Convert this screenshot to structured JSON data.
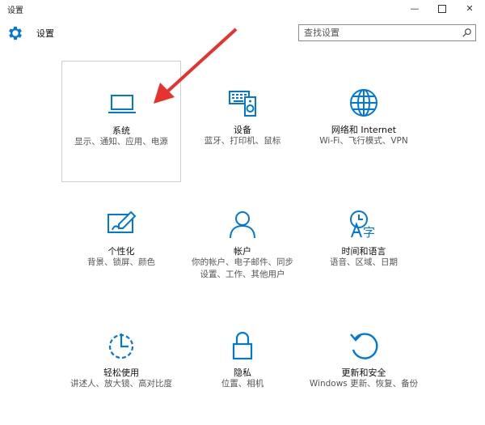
{
  "window": {
    "title": "设置"
  },
  "header": {
    "title": "设置",
    "search": {
      "placeholder": "查找设置"
    }
  },
  "tiles": [
    {
      "name": "系统",
      "desc": "显示、通知、应用、电源",
      "icon": "laptop-icon"
    },
    {
      "name": "设备",
      "desc": "蓝牙、打印机、鼠标",
      "icon": "devices-icon"
    },
    {
      "name": "网络和 Internet",
      "desc": "Wi-Fi、飞行模式、VPN",
      "icon": "globe-icon"
    },
    {
      "name": "个性化",
      "desc": "背景、锁屏、颜色",
      "icon": "personalization-icon"
    },
    {
      "name": "帐户",
      "desc": "你的帐户、电子邮件、同步设置、工作、其他用户",
      "icon": "person-icon"
    },
    {
      "name": "时间和语言",
      "desc": "语音、区域、日期",
      "icon": "time-language-icon"
    },
    {
      "name": "轻松使用",
      "desc": "讲述人、放大镜、高对比度",
      "icon": "ease-of-access-icon"
    },
    {
      "name": "隐私",
      "desc": "位置、相机",
      "icon": "lock-icon"
    },
    {
      "name": "更新和安全",
      "desc": "Windows 更新、恢复、备份",
      "icon": "update-icon"
    }
  ],
  "colors": {
    "accent": "#0078d7",
    "annotation": "#e8322e"
  }
}
